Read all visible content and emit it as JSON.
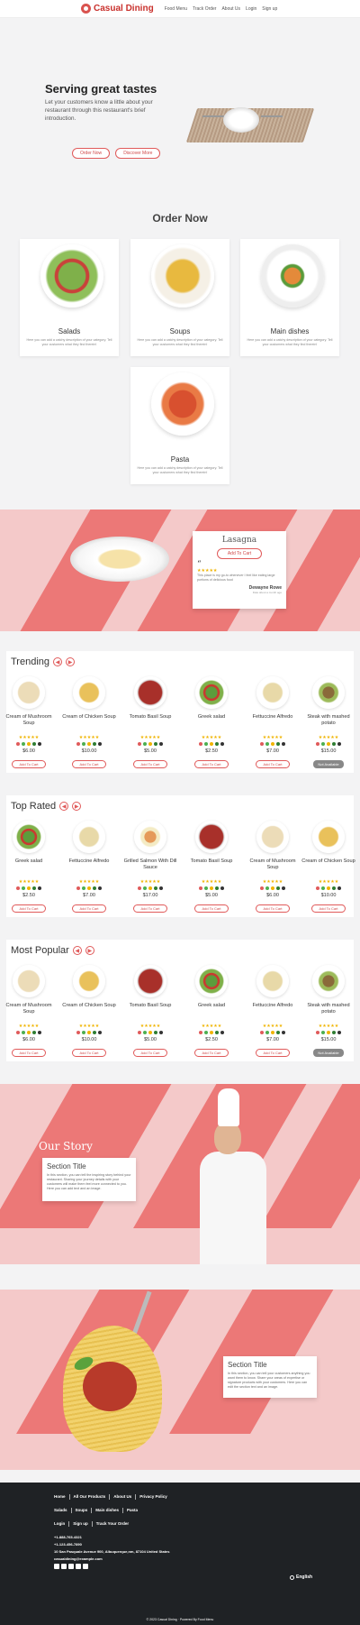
{
  "header": {
    "brand": "Casual Dining",
    "nav": [
      "Food Menu",
      "Track Order",
      "About Us",
      "Login",
      "Sign up"
    ]
  },
  "hero": {
    "title": "Serving great tastes",
    "subtitle": "Let your customers know a little about your restaurant through this restaurant's brief introduction.",
    "order_btn": "Order Now",
    "discover_btn": "Discover More"
  },
  "order": {
    "title": "Order Now",
    "categories": [
      {
        "name": "Salads",
        "desc": "Here you can add a catchy description of your category. Tell your customers what they find therein!"
      },
      {
        "name": "Soups",
        "desc": "Here you can add a catchy description of your category. Tell your customers what they find therein!"
      },
      {
        "name": "Main dishes",
        "desc": "Here you can add a catchy description of your category. Tell your customers what they find therein!"
      },
      {
        "name": "Pasta",
        "desc": "Here you can add a catchy description of your category. Tell your customers what they find therein!"
      }
    ]
  },
  "feature": {
    "dish": "Lasagna",
    "cart_btn": "Add To Cart",
    "quote_mark": "“",
    "stars": "★★★★★",
    "review": "This place is my go-to whenever I feel like eating large portions of delicious food",
    "reviewer": "Dewayne Rowe",
    "when": "Date about a month ago"
  },
  "trending": {
    "title": "Trending",
    "items": [
      {
        "name": "Cream of Mushroom Soup",
        "price": "$6.00",
        "btn": "Add To Cart"
      },
      {
        "name": "Cream of Chicken Soup",
        "price": "$10.00",
        "btn": "Add To Cart"
      },
      {
        "name": "Tomato Basil Soup",
        "price": "$5.00",
        "btn": "Add To Cart"
      },
      {
        "name": "Greek salad",
        "price": "$2.50",
        "btn": "Add To Cart"
      },
      {
        "name": "Fettuccine Alfredo",
        "price": "$7.00",
        "btn": "Add To Cart"
      },
      {
        "name": "Steak with mashed potato",
        "price": "$15.00",
        "btn": "Not Available"
      }
    ]
  },
  "toprated": {
    "title": "Top Rated",
    "items": [
      {
        "name": "Greek salad",
        "price": "$2.50",
        "btn": "Add To Cart"
      },
      {
        "name": "Fettuccine Alfredo",
        "price": "$7.00",
        "btn": "Add To Cart"
      },
      {
        "name": "Grilled Salmon With Dill Sauce",
        "price": "$17.00",
        "btn": "Add To Cart"
      },
      {
        "name": "Tomato Basil Soup",
        "price": "$5.00",
        "btn": "Add To Cart"
      },
      {
        "name": "Cream of Mushroom Soup",
        "price": "$6.00",
        "btn": "Add To Cart"
      },
      {
        "name": "Cream of Chicken Soup",
        "price": "$10.00",
        "btn": "Add To Cart"
      }
    ]
  },
  "popular": {
    "title": "Most Popular",
    "items": [
      {
        "name": "Cream of Mushroom Soup",
        "price": "$6.00",
        "btn": "Add To Cart"
      },
      {
        "name": "Cream of Chicken Soup",
        "price": "$10.00",
        "btn": "Add To Cart"
      },
      {
        "name": "Tomato Basil Soup",
        "price": "$5.00",
        "btn": "Add To Cart"
      },
      {
        "name": "Greek salad",
        "price": "$2.50",
        "btn": "Add To Cart"
      },
      {
        "name": "Fettuccine Alfredo",
        "price": "$7.00",
        "btn": "Add To Cart"
      },
      {
        "name": "Steak with mashed potato",
        "price": "$15.00",
        "btn": "Not Available"
      }
    ]
  },
  "story": {
    "title": "Our Story",
    "box_title": "Section Title",
    "box_text": "In this section, you can tell the inspiring story behind your restaurant. Sharing your journey details with your customers will make them feel more connected to you. Here you can add text and an image."
  },
  "pasta_section": {
    "box_title": "Section Title",
    "box_text": "In this section, you can tell your customers anything you want them to know. Share your areas of expertise or signature products with your customers. Here you can edit the section text and an image."
  },
  "footer": {
    "row1": [
      "Home",
      "All Our Products",
      "About Us",
      "Privacy Policy"
    ],
    "row2": [
      "Salads",
      "Soups",
      "Main dishes",
      "Pasta"
    ],
    "row3": [
      "Login",
      "Sign up",
      "Track Your Order"
    ],
    "phone1": "+1-888-765-4321",
    "phone2": "+1-123-456-7890",
    "address": "10 San Pasquale Avenue 900, Albuquerque,nm, 87104 United States",
    "email": "casualdining@example.com",
    "language": "English",
    "powered": "© 2023 Casual Dining · Powered By Food Menu"
  },
  "colors": {
    "accent": "#e05a5a",
    "stripe": "#ec7877",
    "band_bg": "#f4c9c9",
    "footer_bg": "#1f2225"
  }
}
